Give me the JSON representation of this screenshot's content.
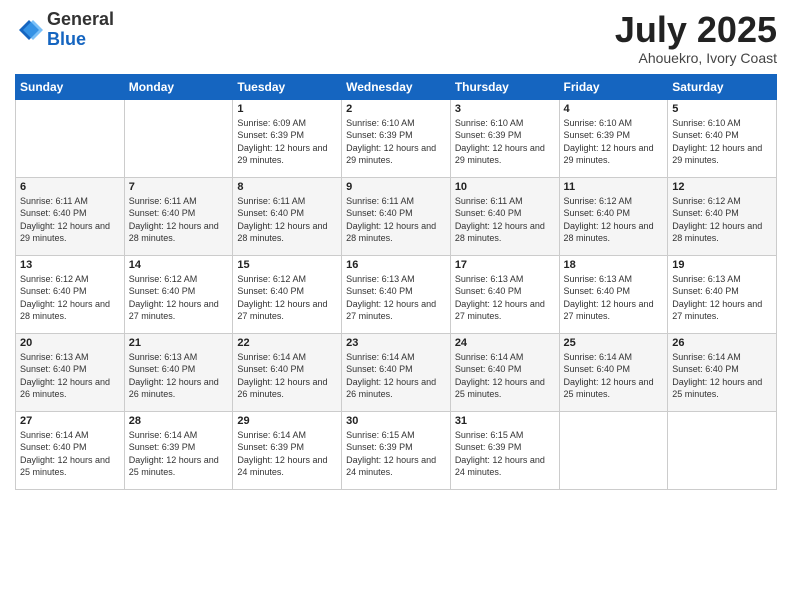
{
  "logo": {
    "general": "General",
    "blue": "Blue"
  },
  "title": "July 2025",
  "subtitle": "Ahouekro, Ivory Coast",
  "days_of_week": [
    "Sunday",
    "Monday",
    "Tuesday",
    "Wednesday",
    "Thursday",
    "Friday",
    "Saturday"
  ],
  "weeks": [
    [
      {
        "day": "",
        "info": ""
      },
      {
        "day": "",
        "info": ""
      },
      {
        "day": "1",
        "info": "Sunrise: 6:09 AM\nSunset: 6:39 PM\nDaylight: 12 hours and 29 minutes."
      },
      {
        "day": "2",
        "info": "Sunrise: 6:10 AM\nSunset: 6:39 PM\nDaylight: 12 hours and 29 minutes."
      },
      {
        "day": "3",
        "info": "Sunrise: 6:10 AM\nSunset: 6:39 PM\nDaylight: 12 hours and 29 minutes."
      },
      {
        "day": "4",
        "info": "Sunrise: 6:10 AM\nSunset: 6:39 PM\nDaylight: 12 hours and 29 minutes."
      },
      {
        "day": "5",
        "info": "Sunrise: 6:10 AM\nSunset: 6:40 PM\nDaylight: 12 hours and 29 minutes."
      }
    ],
    [
      {
        "day": "6",
        "info": "Sunrise: 6:11 AM\nSunset: 6:40 PM\nDaylight: 12 hours and 29 minutes."
      },
      {
        "day": "7",
        "info": "Sunrise: 6:11 AM\nSunset: 6:40 PM\nDaylight: 12 hours and 28 minutes."
      },
      {
        "day": "8",
        "info": "Sunrise: 6:11 AM\nSunset: 6:40 PM\nDaylight: 12 hours and 28 minutes."
      },
      {
        "day": "9",
        "info": "Sunrise: 6:11 AM\nSunset: 6:40 PM\nDaylight: 12 hours and 28 minutes."
      },
      {
        "day": "10",
        "info": "Sunrise: 6:11 AM\nSunset: 6:40 PM\nDaylight: 12 hours and 28 minutes."
      },
      {
        "day": "11",
        "info": "Sunrise: 6:12 AM\nSunset: 6:40 PM\nDaylight: 12 hours and 28 minutes."
      },
      {
        "day": "12",
        "info": "Sunrise: 6:12 AM\nSunset: 6:40 PM\nDaylight: 12 hours and 28 minutes."
      }
    ],
    [
      {
        "day": "13",
        "info": "Sunrise: 6:12 AM\nSunset: 6:40 PM\nDaylight: 12 hours and 28 minutes."
      },
      {
        "day": "14",
        "info": "Sunrise: 6:12 AM\nSunset: 6:40 PM\nDaylight: 12 hours and 27 minutes."
      },
      {
        "day": "15",
        "info": "Sunrise: 6:12 AM\nSunset: 6:40 PM\nDaylight: 12 hours and 27 minutes."
      },
      {
        "day": "16",
        "info": "Sunrise: 6:13 AM\nSunset: 6:40 PM\nDaylight: 12 hours and 27 minutes."
      },
      {
        "day": "17",
        "info": "Sunrise: 6:13 AM\nSunset: 6:40 PM\nDaylight: 12 hours and 27 minutes."
      },
      {
        "day": "18",
        "info": "Sunrise: 6:13 AM\nSunset: 6:40 PM\nDaylight: 12 hours and 27 minutes."
      },
      {
        "day": "19",
        "info": "Sunrise: 6:13 AM\nSunset: 6:40 PM\nDaylight: 12 hours and 27 minutes."
      }
    ],
    [
      {
        "day": "20",
        "info": "Sunrise: 6:13 AM\nSunset: 6:40 PM\nDaylight: 12 hours and 26 minutes."
      },
      {
        "day": "21",
        "info": "Sunrise: 6:13 AM\nSunset: 6:40 PM\nDaylight: 12 hours and 26 minutes."
      },
      {
        "day": "22",
        "info": "Sunrise: 6:14 AM\nSunset: 6:40 PM\nDaylight: 12 hours and 26 minutes."
      },
      {
        "day": "23",
        "info": "Sunrise: 6:14 AM\nSunset: 6:40 PM\nDaylight: 12 hours and 26 minutes."
      },
      {
        "day": "24",
        "info": "Sunrise: 6:14 AM\nSunset: 6:40 PM\nDaylight: 12 hours and 25 minutes."
      },
      {
        "day": "25",
        "info": "Sunrise: 6:14 AM\nSunset: 6:40 PM\nDaylight: 12 hours and 25 minutes."
      },
      {
        "day": "26",
        "info": "Sunrise: 6:14 AM\nSunset: 6:40 PM\nDaylight: 12 hours and 25 minutes."
      }
    ],
    [
      {
        "day": "27",
        "info": "Sunrise: 6:14 AM\nSunset: 6:40 PM\nDaylight: 12 hours and 25 minutes."
      },
      {
        "day": "28",
        "info": "Sunrise: 6:14 AM\nSunset: 6:39 PM\nDaylight: 12 hours and 25 minutes."
      },
      {
        "day": "29",
        "info": "Sunrise: 6:14 AM\nSunset: 6:39 PM\nDaylight: 12 hours and 24 minutes."
      },
      {
        "day": "30",
        "info": "Sunrise: 6:15 AM\nSunset: 6:39 PM\nDaylight: 12 hours and 24 minutes."
      },
      {
        "day": "31",
        "info": "Sunrise: 6:15 AM\nSunset: 6:39 PM\nDaylight: 12 hours and 24 minutes."
      },
      {
        "day": "",
        "info": ""
      },
      {
        "day": "",
        "info": ""
      }
    ]
  ]
}
